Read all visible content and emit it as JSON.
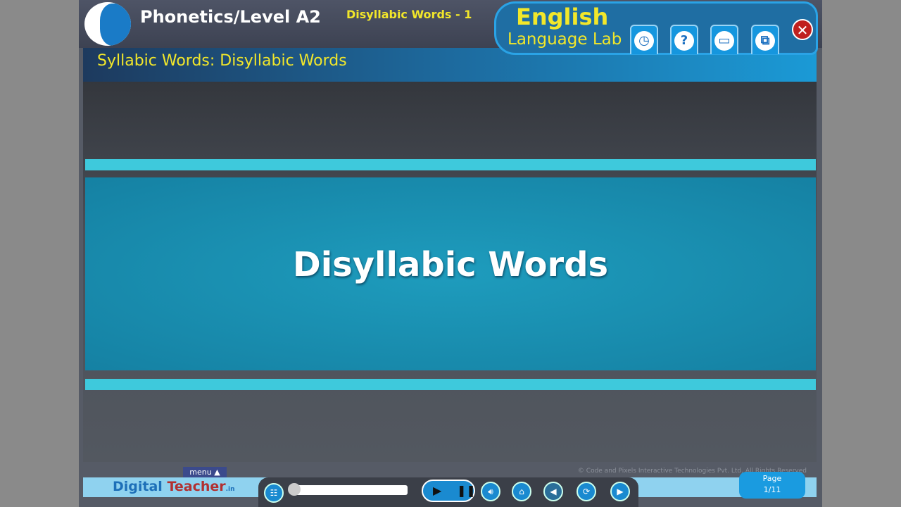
{
  "header": {
    "title": "Phonetics/Level A2",
    "lesson": "Disyllabic Words - 1",
    "brand_line1": "English",
    "brand_line2": "Language Lab",
    "close_icon": "close-icon"
  },
  "toolbar": {
    "buttons": [
      {
        "icon": "folder-clock-icon",
        "glyph": "◷"
      },
      {
        "icon": "help-icon",
        "glyph": "?"
      },
      {
        "icon": "book-icon",
        "glyph": "▭"
      },
      {
        "icon": "window-icon",
        "glyph": "⧉"
      }
    ]
  },
  "section_title": "Syllabic Words: Disyllabic Words",
  "slide": {
    "heading": "Disyllabic Words"
  },
  "footer": {
    "logo_part1": "Digital",
    "logo_part2": " Teacher",
    "logo_suffix": ".in",
    "menu_label": "menu ▲",
    "copyright": "© Code and Pixels Interactive Technologies  Pvt. Ltd. All Rights Reserved",
    "page_label": "Page",
    "page_value": "1/11",
    "progress": 0.0
  },
  "colors": {
    "accent": "#1a8ad0",
    "title_yellow": "#f2e72a",
    "stripe": "#3ec9dc"
  }
}
